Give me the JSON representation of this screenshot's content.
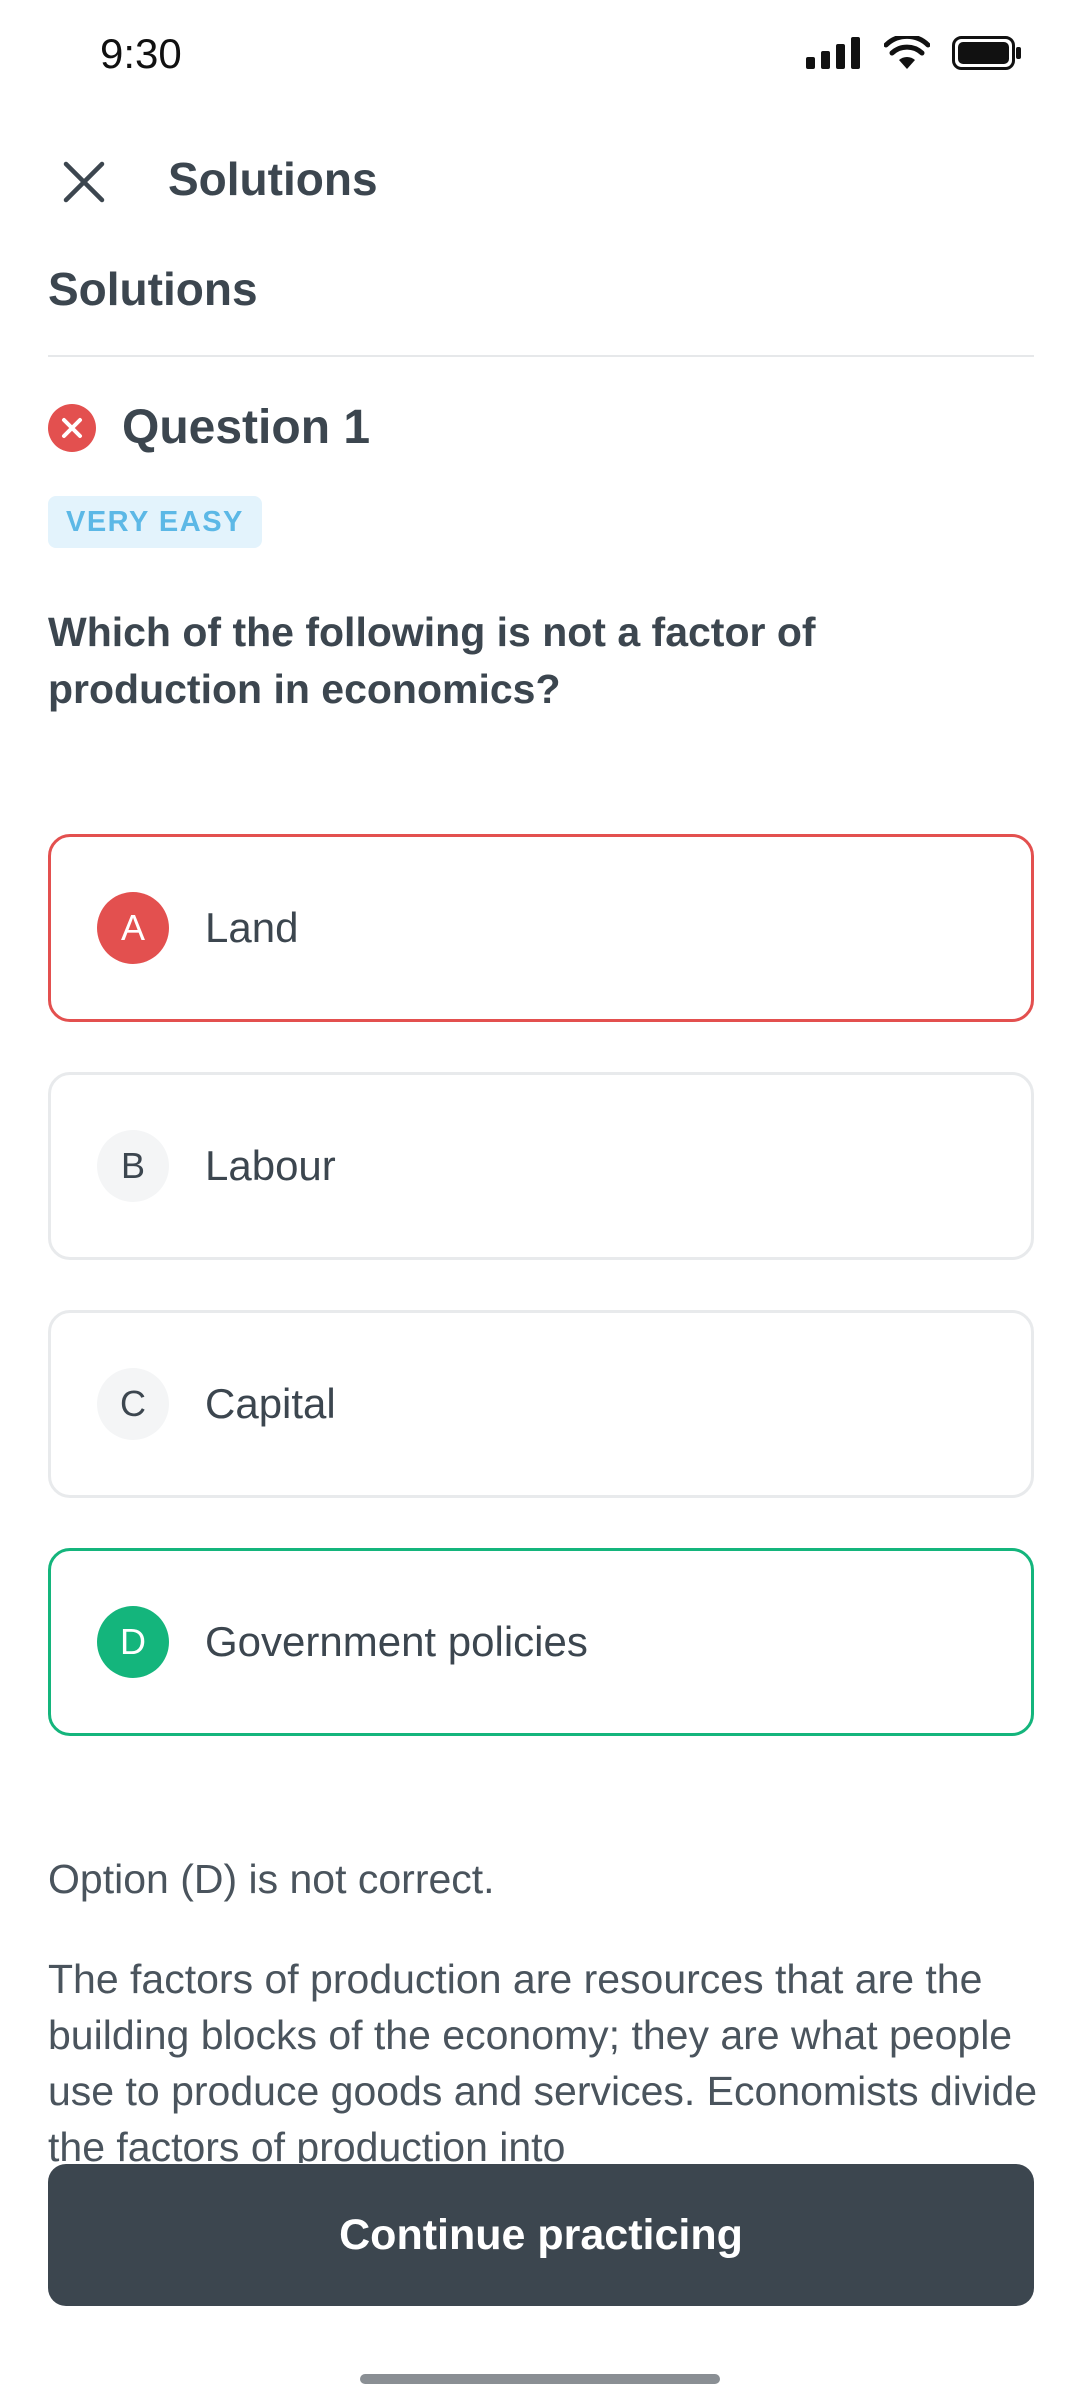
{
  "status_bar": {
    "time": "9:30"
  },
  "header": {
    "title": "Solutions"
  },
  "section_title": "Solutions",
  "question": {
    "number_label": "Question 1",
    "difficulty": "VERY EASY",
    "text": "Which of the following is not a factor of production in economics?"
  },
  "options": [
    {
      "letter": "A",
      "label": "Land",
      "state": "wrong"
    },
    {
      "letter": "B",
      "label": "Labour",
      "state": "neutral"
    },
    {
      "letter": "C",
      "label": "Capital",
      "state": "neutral"
    },
    {
      "letter": "D",
      "label": "Government policies",
      "state": "correct"
    }
  ],
  "explanation": {
    "verdict": "Option (D) is not correct.",
    "body": "The factors of production are resources that are the building blocks of the economy; they are what people use to produce goods and services. Economists divide the factors of production into"
  },
  "continue_button": {
    "label": "Continue practicing"
  },
  "colors": {
    "wrong": "#e3504f",
    "correct": "#14b57c",
    "badge_text": "#5cb8e6",
    "badge_bg": "#e3f3fc",
    "primary_dark": "#3c464f"
  },
  "icons": {
    "close": "close-icon",
    "question_status": "wrong-answer-icon",
    "signal": "signal-icon",
    "wifi": "wifi-icon",
    "battery": "battery-icon"
  }
}
